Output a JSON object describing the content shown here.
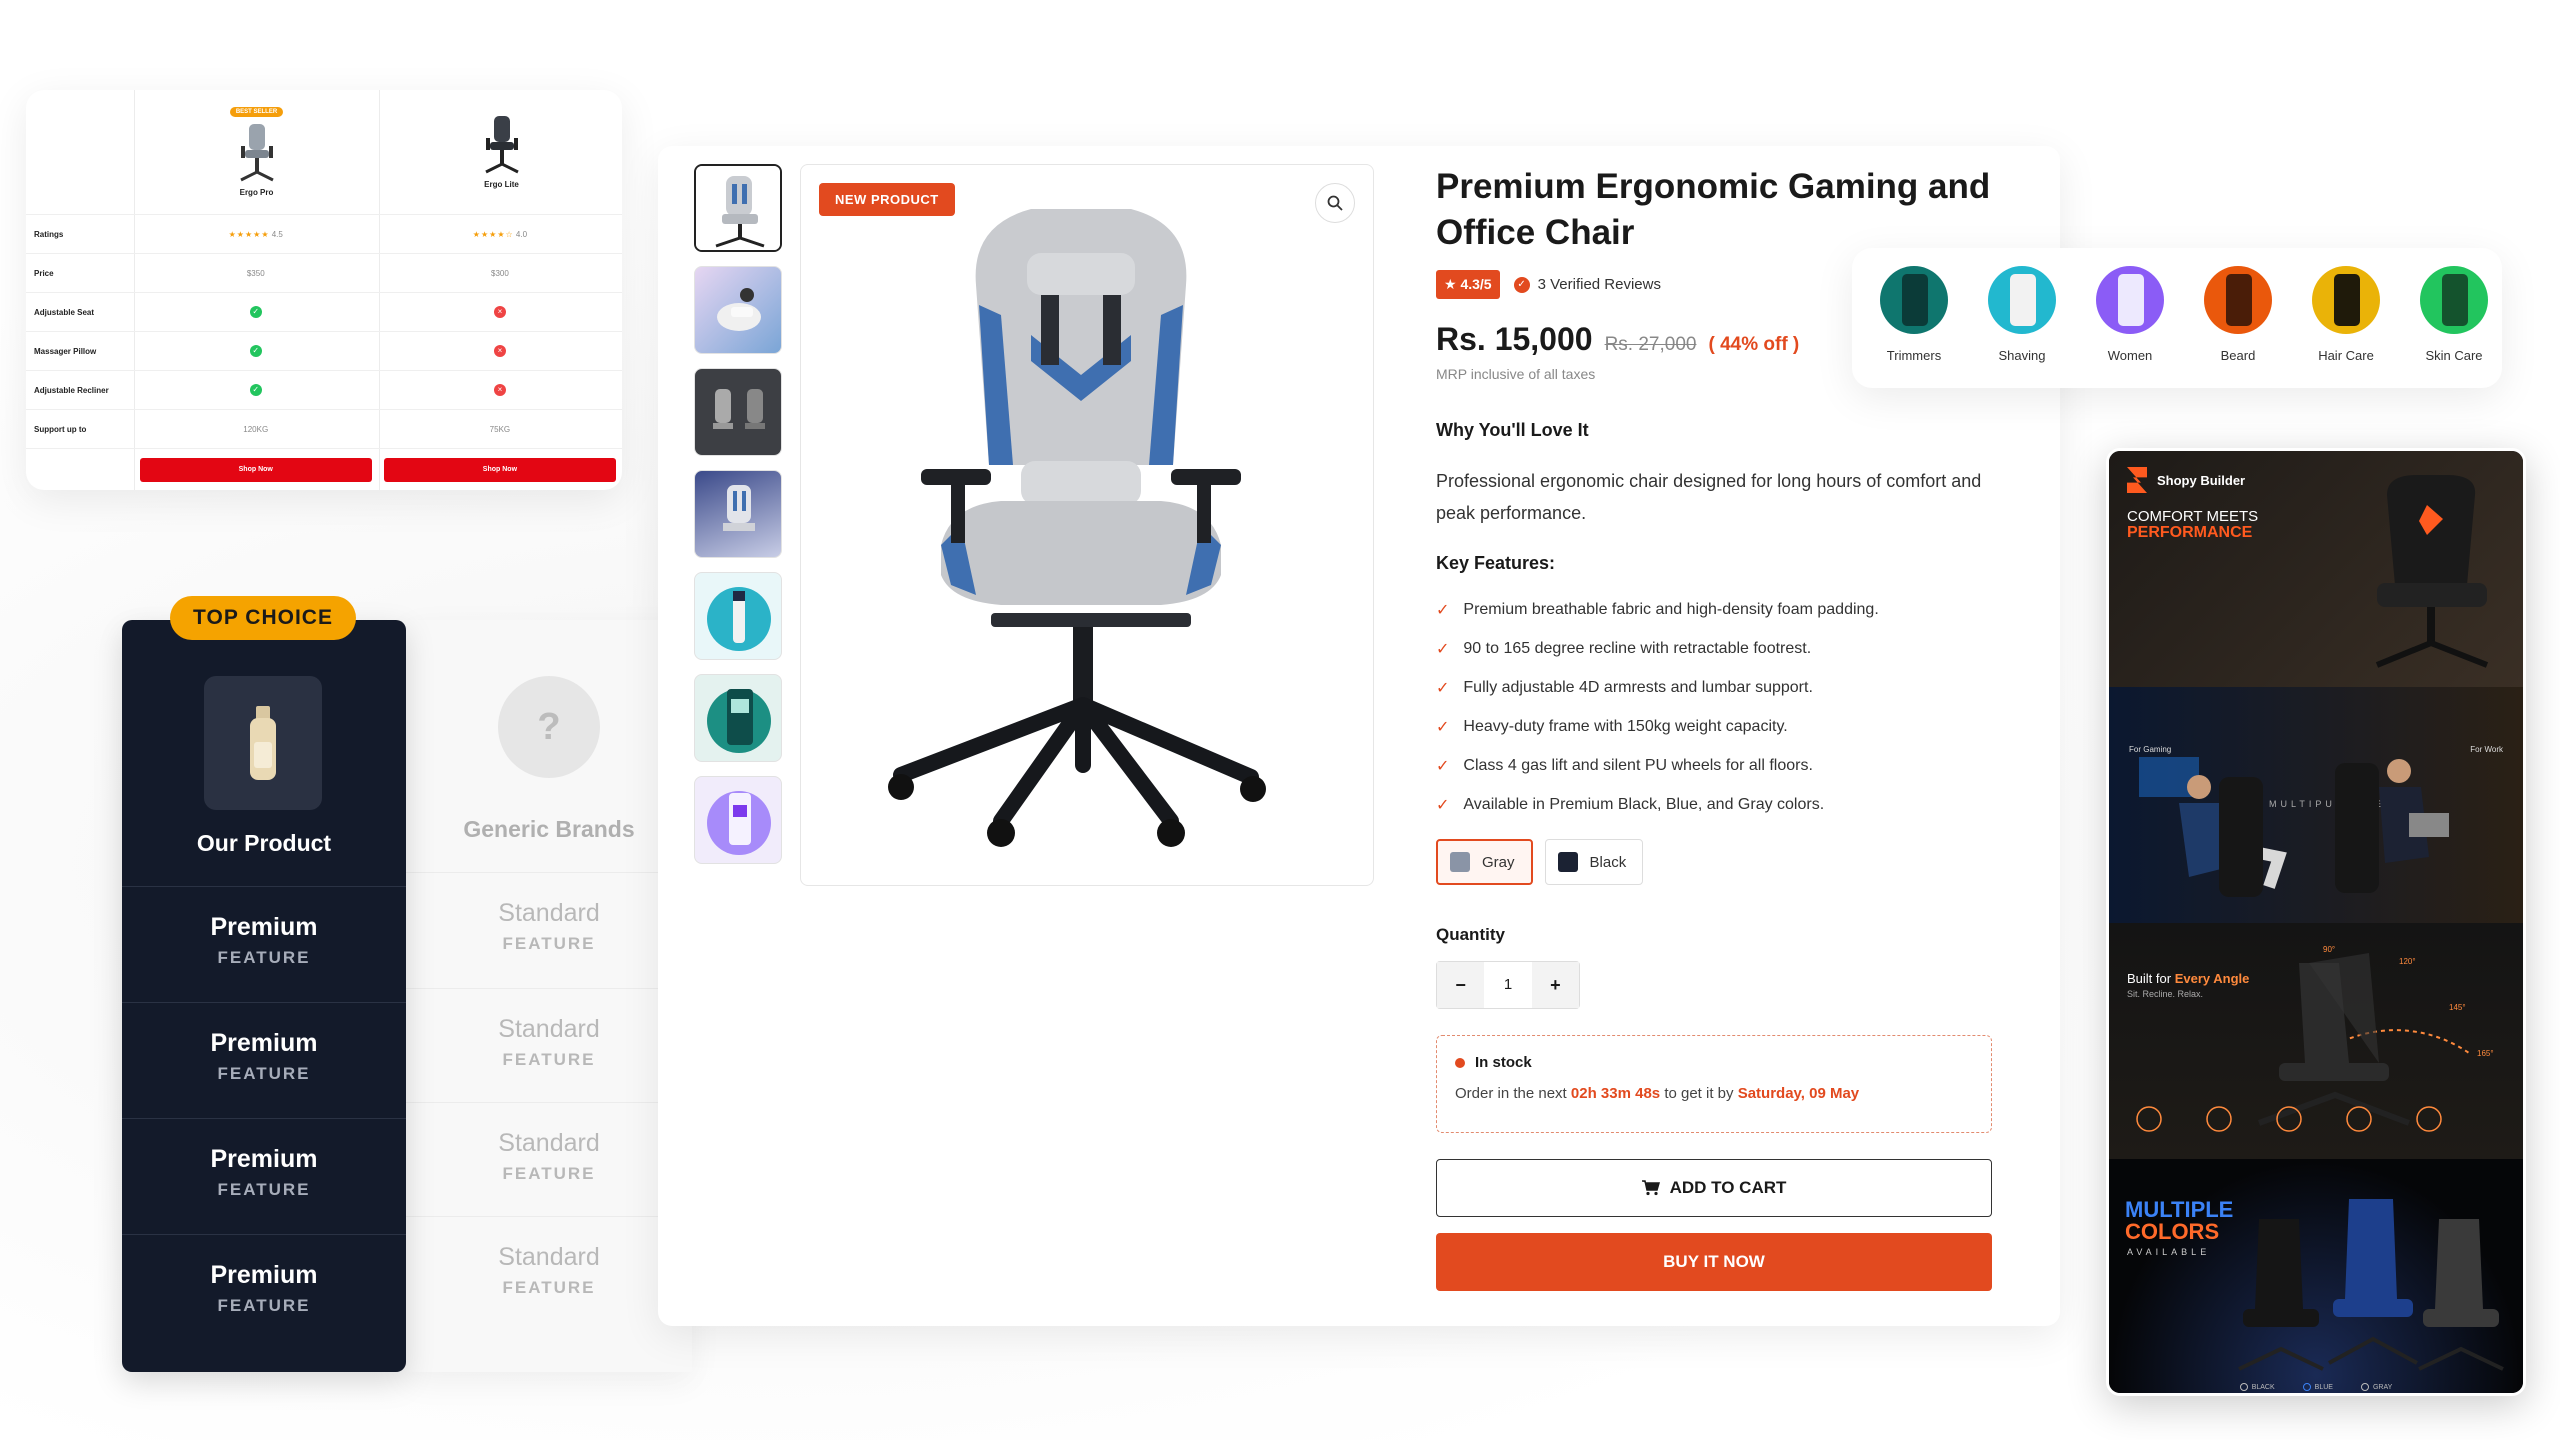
{
  "comparison": {
    "products": [
      {
        "badge": "BEST SELLER",
        "name": "Ergo Pro"
      },
      {
        "badge": "",
        "name": "Ergo Lite"
      }
    ],
    "rows": [
      {
        "label": "Ratings",
        "values": [
          "4.5",
          "4.0"
        ],
        "kind": "stars"
      },
      {
        "label": "Price",
        "values": [
          "$350",
          "$300"
        ],
        "kind": "text"
      },
      {
        "label": "Adjustable Seat",
        "values": [
          true,
          false
        ],
        "kind": "bool"
      },
      {
        "label": "Massager Pillow",
        "values": [
          true,
          false
        ],
        "kind": "bool"
      },
      {
        "label": "Adjustable Recliner",
        "values": [
          true,
          false
        ],
        "kind": "bool"
      },
      {
        "label": "Support up to",
        "values": [
          "120KG",
          "75KG"
        ],
        "kind": "text"
      }
    ],
    "shop_label": "Shop Now"
  },
  "top_choice": {
    "badge": "TOP CHOICE",
    "our_title": "Our Product",
    "generic_title": "Generic Brands",
    "generic_mark": "?",
    "our_rows": [
      {
        "big": "Premium",
        "small": "FEATURE"
      },
      {
        "big": "Premium",
        "small": "FEATURE"
      },
      {
        "big": "Premium",
        "small": "FEATURE"
      },
      {
        "big": "Premium",
        "small": "FEATURE"
      }
    ],
    "generic_rows": [
      {
        "big": "Standard",
        "small": "FEATURE"
      },
      {
        "big": "Standard",
        "small": "FEATURE"
      },
      {
        "big": "Standard",
        "small": "FEATURE"
      },
      {
        "big": "Standard",
        "small": "FEATURE"
      }
    ]
  },
  "product": {
    "badge": "NEW PRODUCT",
    "title": "Premium Ergonomic Gaming and Office Chair",
    "rating": "4.3/5",
    "reviews": "3 Verified Reviews",
    "price": "Rs. 15,000",
    "mrp": "Rs. 27,000",
    "off": "( 44% off )",
    "tax_note": "MRP inclusive of all taxes",
    "why_heading": "Why You'll Love It",
    "description": "Professional ergonomic chair designed for long hours of comfort and peak performance.",
    "features_heading": "Key Features:",
    "features": [
      "Premium breathable fabric and high-density foam padding.",
      "90 to 165 degree recline with retractable footrest.",
      "Fully adjustable 4D armrests and lumbar support.",
      "Heavy-duty frame with 150kg weight capacity.",
      "Class 4 gas lift and silent PU wheels for all floors.",
      "Available in Premium Black, Blue, and Gray colors."
    ],
    "colors": [
      {
        "label": "Gray",
        "swatch": "#8a94a6",
        "selected": true
      },
      {
        "label": "Black",
        "swatch": "#1b2233",
        "selected": false
      }
    ],
    "quantity_label": "Quantity",
    "quantity": "1",
    "qty_minus": "−",
    "qty_plus": "+",
    "stock_status": "In stock",
    "order_prefix": "Order in the next",
    "countdown": "02h 33m 48s",
    "order_mid": "to get it by",
    "delivery_date": "Saturday, 09 May",
    "add_to_cart": "ADD TO CART",
    "buy_now": "BUY IT NOW"
  },
  "categories": [
    {
      "label": "Trimmers",
      "color": "#0f766e"
    },
    {
      "label": "Shaving",
      "color": "#22b8cf"
    },
    {
      "label": "Women",
      "color": "#8b5cf6"
    },
    {
      "label": "Beard",
      "color": "#ea580c"
    },
    {
      "label": "Hair Care",
      "color": "#eab308"
    },
    {
      "label": "Skin Care",
      "color": "#22c55e"
    }
  ],
  "banner": {
    "brand": "Shopy Builder",
    "comfort_line1": "COMFORT MEETS",
    "comfort_line2": "PERFORMANCE",
    "for_gaming": "For Gaming",
    "for_work": "For Work",
    "multipurpose": "MULTIPURPOSE",
    "angle_pre": "Built for ",
    "angle_hl": "Every Angle",
    "angle_sub": "Sit. Recline. Relax.",
    "angles": [
      "90°",
      "120°",
      "145°",
      "165°"
    ],
    "multiple": "MULTIPLE",
    "colors_word": "COLORS",
    "available": "AVAILABLE",
    "color_names": [
      "BLACK",
      "BLUE",
      "GRAY"
    ]
  },
  "accent": "#e24a1f"
}
